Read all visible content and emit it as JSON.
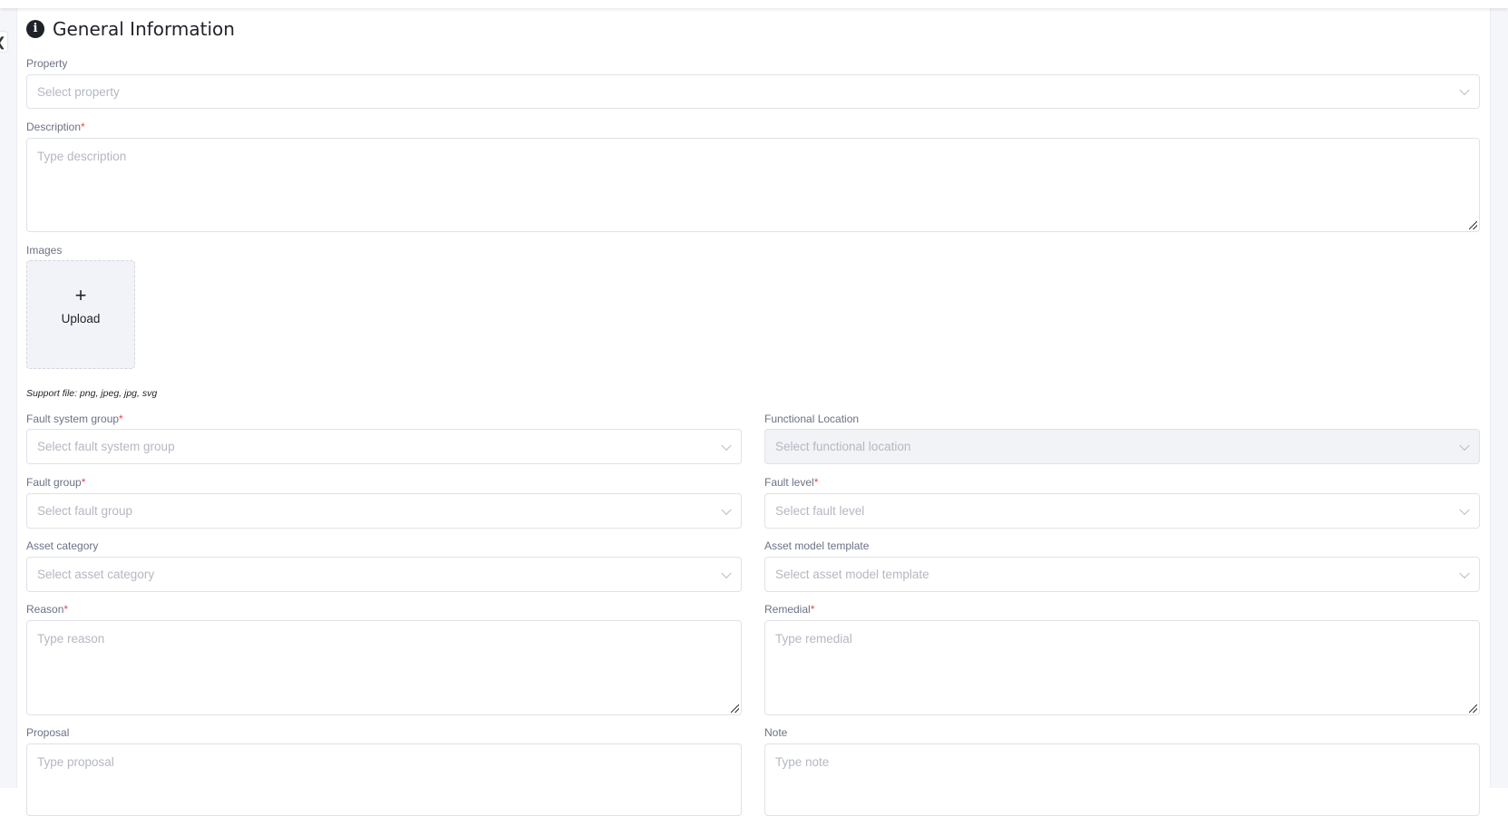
{
  "section": {
    "title": "General Information",
    "icon": "info-icon"
  },
  "fields": {
    "property": {
      "label": "Property",
      "placeholder": "Select property"
    },
    "description": {
      "label": "Description",
      "required": "*",
      "placeholder": "Type description"
    },
    "images": {
      "label": "Images",
      "upload_label": "Upload",
      "upload_icon": "+",
      "support": "Support file: png, jpeg, jpg, svg"
    },
    "fault_system_group": {
      "label": "Fault system group",
      "required": "*",
      "placeholder": "Select fault system group"
    },
    "functional_location": {
      "label": "Functional Location",
      "placeholder": "Select functional location"
    },
    "fault_group": {
      "label": "Fault group",
      "required": "*",
      "placeholder": "Select fault group"
    },
    "fault_level": {
      "label": "Fault level",
      "required": "*",
      "placeholder": "Select fault level"
    },
    "asset_category": {
      "label": "Asset category",
      "placeholder": "Select asset category"
    },
    "asset_model_template": {
      "label": "Asset model template",
      "placeholder": "Select asset model template"
    },
    "reason": {
      "label": "Reason",
      "required": "*",
      "placeholder": "Type reason"
    },
    "remedial": {
      "label": "Remedial",
      "required": "*",
      "placeholder": "Type remedial"
    },
    "proposal": {
      "label": "Proposal",
      "placeholder": "Type proposal"
    },
    "note": {
      "label": "Note",
      "placeholder": "Type note"
    }
  },
  "colors": {
    "required": "#e5484d",
    "text": "#1f2329",
    "label": "#6b7285"
  }
}
